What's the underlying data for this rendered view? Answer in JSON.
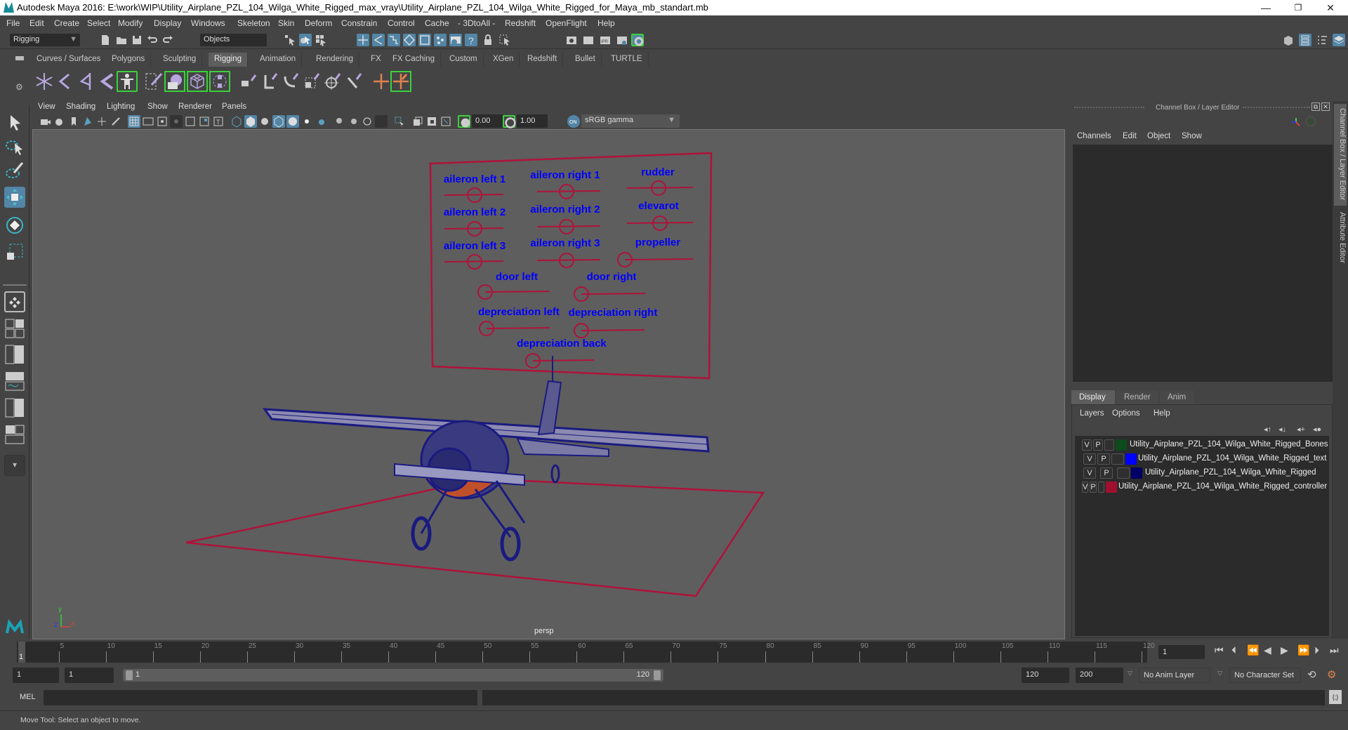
{
  "window": {
    "title": "Autodesk Maya 2016: E:\\work\\WIP\\Utility_Airplane_PZL_104_Wilga_White_Rigged_max_vray\\Utility_Airplane_PZL_104_Wilga_White_Rigged_for_Maya_mb_standart.mb",
    "controls": {
      "minimize": "—",
      "restore": "❐",
      "close": "✕"
    }
  },
  "menubar": [
    "File",
    "Edit",
    "Create",
    "Select",
    "Modify",
    "Display",
    "Windows",
    "Skeleton",
    "Skin",
    "Deform",
    "Constrain",
    "Control",
    "Cache",
    "- 3DtoAll -",
    "Redshift",
    "OpenFlight",
    "Help"
  ],
  "statusline": {
    "menuset": "Rigging",
    "selection_mode": "Objects"
  },
  "shelf": {
    "tabs": [
      "Curves / Surfaces",
      "Polygons",
      "Sculpting",
      "Rigging",
      "Animation",
      "Rendering",
      "FX",
      "FX Caching",
      "Custom",
      "XGen",
      "Redshift",
      "Bullet",
      "TURTLE"
    ],
    "active_tab": "Rigging",
    "icons": [
      "joint-tool-icon",
      "ik-handle-icon",
      "ik-spline-icon",
      "insert-joint-icon",
      "quick-rig-icon",
      "paint-weights-icon",
      "smooth-bind-icon",
      "lattice-icon",
      "cluster-icon",
      "parent-constraint-icon",
      "point-constraint-icon",
      "orient-constraint-icon",
      "scale-constraint-icon",
      "aim-constraint-icon",
      "pole-vector-icon",
      "locator-icon",
      "custom-rig-icon"
    ]
  },
  "viewport": {
    "menu": [
      "View",
      "Shading",
      "Lighting",
      "Show",
      "Renderer",
      "Panels"
    ],
    "exposure": "0.00",
    "gamma": "1.00",
    "colorspace": "sRGB gamma",
    "camera_label": "persp",
    "axis": {
      "x": "x",
      "y": "y",
      "z": "z"
    },
    "controls": [
      {
        "label": "aileron left 1"
      },
      {
        "label": "aileron right 1"
      },
      {
        "label": "rudder"
      },
      {
        "label": "aileron left 2"
      },
      {
        "label": "aileron right 2"
      },
      {
        "label": "elevarot"
      },
      {
        "label": "aileron left 3"
      },
      {
        "label": "aileron right 3"
      },
      {
        "label": "propeller"
      },
      {
        "label": "door left"
      },
      {
        "label": "door right"
      },
      {
        "label": "depreciation left"
      },
      {
        "label": "depreciation right"
      },
      {
        "label": "depreciation back"
      }
    ],
    "colors": {
      "text": "#0000ff",
      "controller": "#b0123a",
      "mesh": "#1a1a80",
      "bg": "#5e5e5e"
    }
  },
  "channelbox": {
    "title": "Channel Box / Layer Editor",
    "menu": [
      "Channels",
      "Edit",
      "Object",
      "Show"
    ]
  },
  "layereditor": {
    "tabs": [
      "Display",
      "Render",
      "Anim"
    ],
    "active_tab": "Display",
    "menu": [
      "Layers",
      "Options",
      "Help"
    ],
    "layers": [
      {
        "v": "V",
        "p": "P",
        "name": "Utility_Airplane_PZL_104_Wilga_White_Rigged_Bones",
        "color": "#0d4a1e"
      },
      {
        "v": "V",
        "p": "P",
        "name": "Utility_Airplane_PZL_104_Wilga_White_Rigged_text",
        "color": "#0000ff"
      },
      {
        "v": "V",
        "p": "P",
        "name": "Utility_Airplane_PZL_104_Wilga_White_Rigged",
        "color": "#000066"
      },
      {
        "v": "V",
        "p": "P",
        "name": "Utility_Airplane_PZL_104_Wilga_White_Rigged_controller",
        "color": "#a0102e"
      }
    ]
  },
  "sidetabs": [
    "Channel Box / Layer Editor",
    "Attribute Editor"
  ],
  "timeline": {
    "ticks": [
      5,
      10,
      15,
      20,
      25,
      30,
      35,
      40,
      45,
      50,
      55,
      60,
      65,
      70,
      75,
      80,
      85,
      90,
      95,
      100,
      105,
      110,
      115,
      120
    ],
    "start": 1,
    "end": 120,
    "current_frame": "1",
    "current_frame_marker": "1"
  },
  "range": {
    "start_field": "1",
    "playback_start": "1",
    "slider_start": "1",
    "slider_end": "120",
    "playback_end": "120",
    "end_field": "200",
    "anim_layer": "No Anim Layer",
    "character_set": "No Character Set"
  },
  "commandline": {
    "label": "MEL"
  },
  "status": {
    "message": "Move Tool: Select an object to move."
  }
}
